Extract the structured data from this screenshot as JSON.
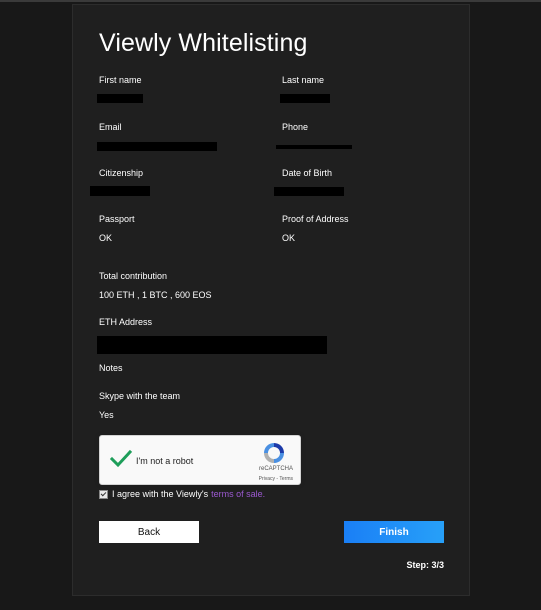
{
  "form": {
    "title": "Viewly Whitelisting",
    "first_name_label": "First name",
    "last_name_label": "Last name",
    "email_label": "Email",
    "phone_label": "Phone",
    "citizenship_label": "Citizenship",
    "dob_label": "Date of Birth",
    "passport_label": "Passport",
    "passport_value": "OK",
    "proof_label": "Proof of Address",
    "proof_value": "OK",
    "contribution_label": "Total contribution",
    "contribution_value": "100 ETH , 1 BTC , 600 EOS",
    "eth_label": "ETH Address",
    "notes_label": "Notes",
    "skype_label": "Skype with the team",
    "skype_value": "Yes"
  },
  "captcha": {
    "label": "I'm not a robot",
    "brand": "reCAPTCHA",
    "links": "Privacy - Terms",
    "checked": true
  },
  "agreement": {
    "text": "I agree with the Viewly's",
    "link": "terms of sale."
  },
  "buttons": {
    "back": "Back",
    "finish": "Finish"
  },
  "step": "Step: 3/3",
  "colors": {
    "background": "#181818",
    "card": "#1f1f1f",
    "accent": "#1a7ff6",
    "link": "#9b59d0",
    "check": "#1e9e5a"
  }
}
